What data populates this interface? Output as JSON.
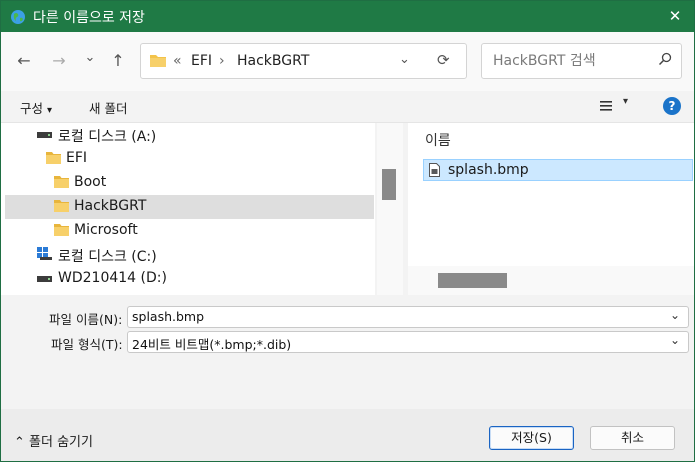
{
  "window": {
    "title": "다른 이름으로 저장",
    "close_glyph": "✕"
  },
  "nav": {
    "back_glyph": "←",
    "forward_glyph": "→",
    "recent_glyph": "⌄",
    "up_glyph": "↑",
    "breadcrumb": {
      "overflow": "«",
      "parts": [
        "EFI",
        "HackBGRT"
      ],
      "sep": "›"
    },
    "dropdown_glyph": "⌄",
    "refresh_glyph": "⟳",
    "search_placeholder": "HackBGRT 검색"
  },
  "toolbar": {
    "organize": "구성",
    "organize_caret": "▾",
    "new_folder": "새 폴더",
    "view_caret": "▾",
    "help": "?"
  },
  "tree": {
    "items": [
      {
        "label": "로컬 디스크 (A:)",
        "icon": "drive-icon"
      },
      {
        "label": "EFI",
        "icon": "folder-icon"
      },
      {
        "label": "Boot",
        "icon": "folder-icon"
      },
      {
        "label": "HackBGRT",
        "icon": "folder-icon",
        "selected": true
      },
      {
        "label": "Microsoft",
        "icon": "folder-icon"
      },
      {
        "label": "로컬 디스크 (C:)",
        "icon": "windows-drive-icon"
      },
      {
        "label": "WD210414 (D:)",
        "icon": "drive-icon"
      }
    ]
  },
  "files": {
    "column_name": "이름",
    "items": [
      {
        "name": "splash.bmp",
        "icon": "bitmap-file-icon",
        "selected": true
      }
    ]
  },
  "form": {
    "filename_label": "파일 이름(N):",
    "filename_value": "splash.bmp",
    "filetype_label": "파일 형식(T):",
    "filetype_value": "24비트 비트맵(*.bmp;*.dib)",
    "dropdown_glyph": "⌄"
  },
  "footer": {
    "hide_folders": "⌃  폴더 숨기기",
    "save": "저장(S)",
    "cancel": "취소"
  },
  "colors": {
    "titlebar": "#1f7a45",
    "selection": "#cce8ff",
    "tree_selection": "#dedede",
    "folder": "#f3c34a",
    "accent": "#1a64c3"
  }
}
